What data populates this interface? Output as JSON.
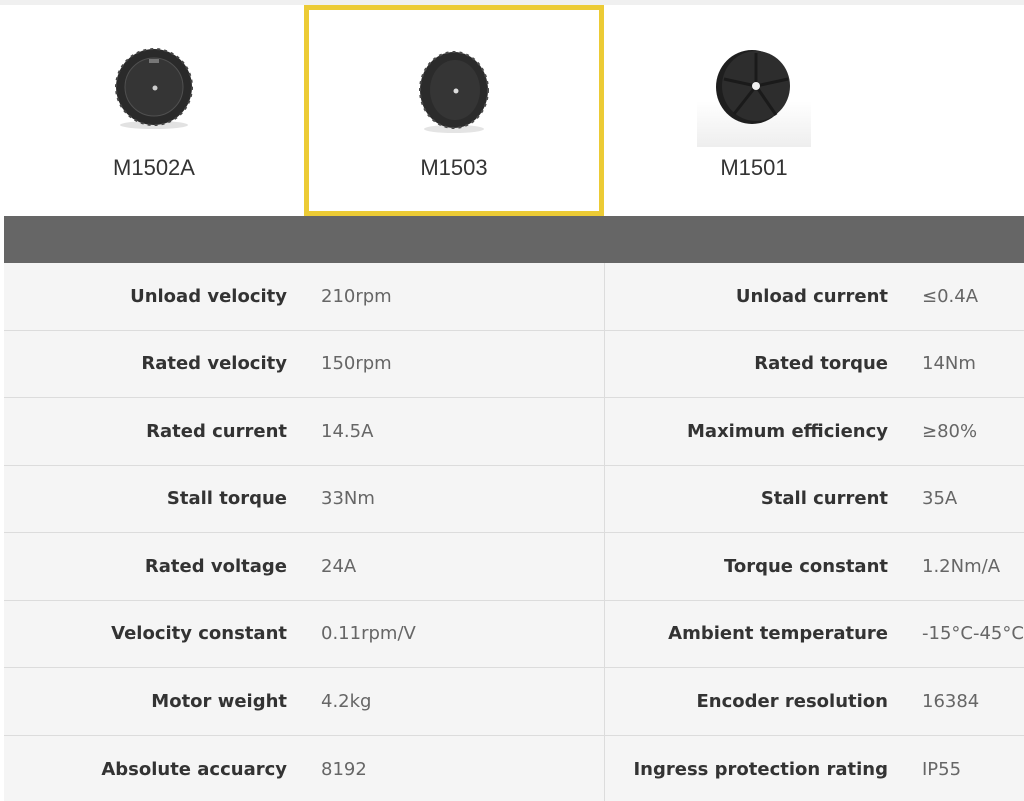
{
  "products": [
    {
      "name": "M1502A",
      "icon": "hub-motor-wheel-icon",
      "selected": false
    },
    {
      "name": "M1503",
      "icon": "hub-motor-wheel-icon",
      "selected": true
    },
    {
      "name": "M1501",
      "icon": "hub-motor-disc-icon",
      "selected": false
    }
  ],
  "colors": {
    "selected_border": "#eccb35",
    "header_bar": "#666666",
    "row_bg": "#f5f5f5"
  },
  "specs": [
    {
      "left_label": "Unload velocity",
      "left_value": "210rpm",
      "right_label": "Unload current",
      "right_value": "≤0.4A"
    },
    {
      "left_label": "Rated velocity",
      "left_value": "150rpm",
      "right_label": "Rated torque",
      "right_value": "14Nm"
    },
    {
      "left_label": "Rated current",
      "left_value": "14.5A",
      "right_label": "Maximum efficiency",
      "right_value": "≥80%"
    },
    {
      "left_label": "Stall torque",
      "left_value": "33Nm",
      "right_label": "Stall current",
      "right_value": "35A"
    },
    {
      "left_label": "Rated voltage",
      "left_value": "24A",
      "right_label": "Torque constant",
      "right_value": "1.2Nm/A"
    },
    {
      "left_label": "Velocity constant",
      "left_value": "0.11rpm/V",
      "right_label": "Ambient temperature",
      "right_value": "-15°C-45°C"
    },
    {
      "left_label": "Motor weight",
      "left_value": "4.2kg",
      "right_label": "Encoder resolution",
      "right_value": "16384"
    },
    {
      "left_label": "Absolute accuarcy",
      "left_value": "8192",
      "right_label": "Ingress protection rating",
      "right_value": "IP55"
    }
  ]
}
